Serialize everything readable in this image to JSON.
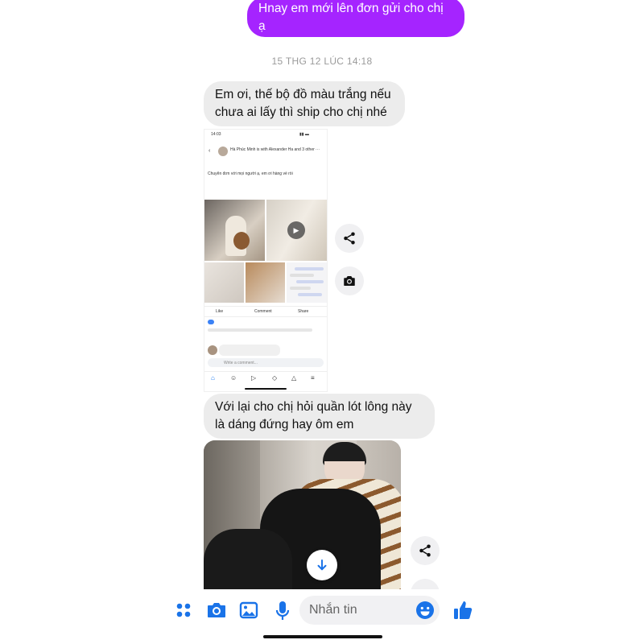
{
  "colors": {
    "outgoing_bubble": "#a524ff",
    "incoming_bubble": "#ececec",
    "accent": "#1a73e8",
    "timestamp": "#9a9a9a"
  },
  "messages": {
    "outgoing_1": "Hnay em mới lên đơn gửi cho chị ạ",
    "timestamp_1": "15 THG 12 LÚC 14:18",
    "incoming_1": "Em ơi, thế bộ đồ màu trắng nếu chưa ai lấy thì ship cho chị nhé",
    "incoming_2": "Với lại cho chị hỏi quần lót lông này là dáng đứng hay ôm em"
  },
  "shared_post": {
    "status_time": "14:03",
    "author": "Hà Phúc Minh is with Alexander Ha and 3 others",
    "post_caption": "Chuyển đơn với mọi người ạ, em ơi hàng về rồi",
    "like": "Like",
    "comment": "Comment",
    "share": "Share",
    "write_comment": "Write a comment..."
  },
  "icons": {
    "share": "share-icon",
    "camera": "camera-icon",
    "scroll_down": "arrow-down-icon",
    "apps": "apps-grid-icon",
    "gallery": "image-icon",
    "mic": "microphone-icon",
    "emoji": "emoji-icon",
    "like": "thumbs-up-icon"
  },
  "composer": {
    "placeholder": "Nhắn tin"
  }
}
